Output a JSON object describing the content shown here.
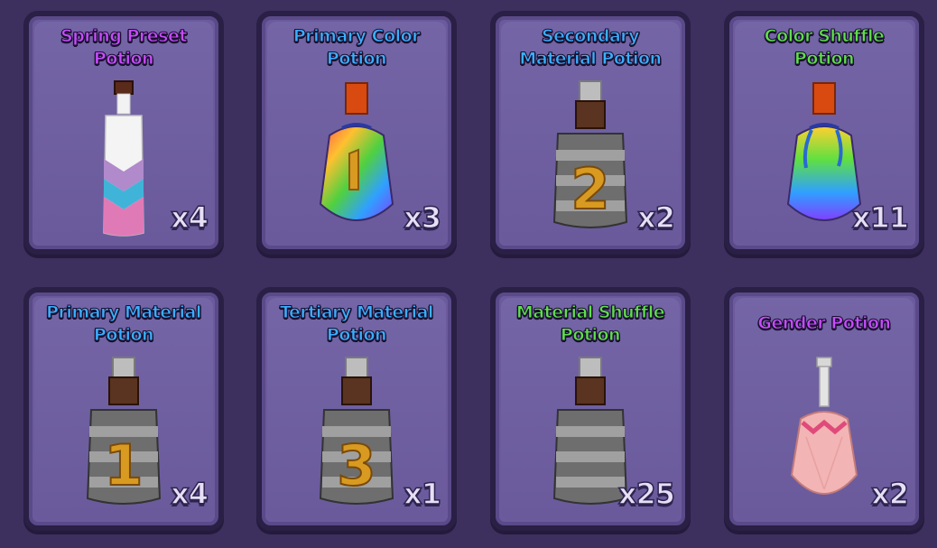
{
  "inventory": {
    "items": [
      {
        "title": "Spring Preset Potion",
        "count": "x4",
        "color": "#c040ff",
        "icon": "spring-preset-potion-icon"
      },
      {
        "title": "Primary Color Potion",
        "count": "x3",
        "color": "#3ab0ff",
        "icon": "primary-color-potion-icon"
      },
      {
        "title": "Secondary Material Potion",
        "count": "x2",
        "color": "#3ab0ff",
        "icon": "secondary-material-potion-icon"
      },
      {
        "title": "Color Shuffle Potion",
        "count": "x11",
        "color": "#5ee04a",
        "icon": "color-shuffle-potion-icon"
      },
      {
        "title": "Primary Material Potion",
        "count": "x4",
        "color": "#3ab0ff",
        "icon": "primary-material-potion-icon"
      },
      {
        "title": "Tertiary Material Potion",
        "count": "x1",
        "color": "#3ab0ff",
        "icon": "tertiary-material-potion-icon"
      },
      {
        "title": "Material Shuffle Potion",
        "count": "x25",
        "color": "#5ee04a",
        "icon": "material-shuffle-potion-icon"
      },
      {
        "title": "Gender Potion",
        "count": "x2",
        "color": "#c040ff",
        "icon": "gender-potion-icon"
      }
    ]
  }
}
